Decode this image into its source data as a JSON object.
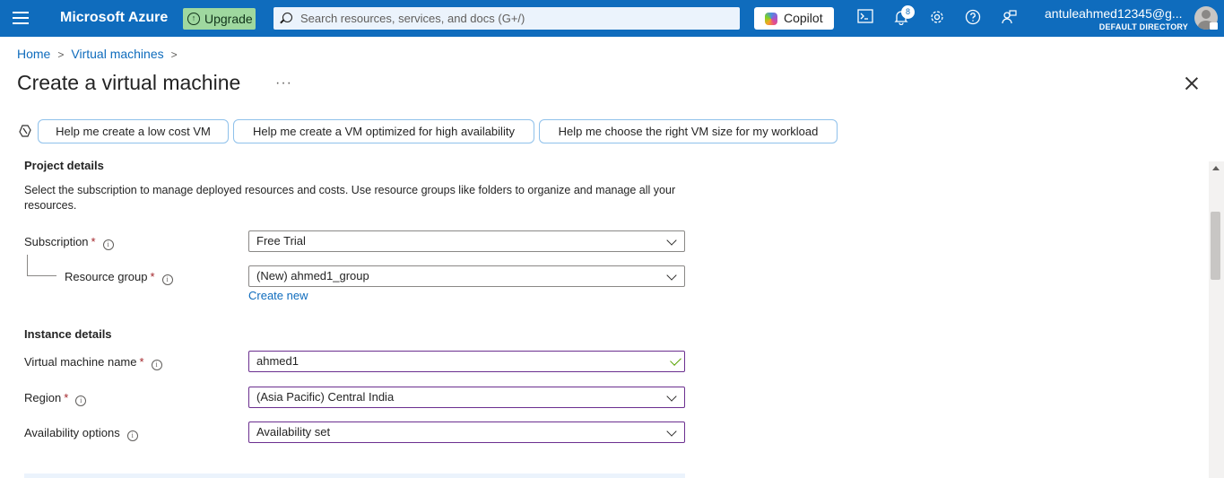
{
  "topbar": {
    "brand": "Microsoft Azure",
    "upgrade_label": "Upgrade",
    "search_placeholder": "Search resources, services, and docs (G+/)",
    "copilot_label": "Copilot",
    "notification_count": "8",
    "account_email": "antuleahmed12345@g...",
    "account_directory": "DEFAULT DIRECTORY",
    "icons": [
      "cloud-shell-icon",
      "bell-icon",
      "gear-icon",
      "help-icon",
      "feedback-icon"
    ]
  },
  "breadcrumb": {
    "home": "Home",
    "virtual_machines": "Virtual machines"
  },
  "page": {
    "title": "Create a virtual machine",
    "more": "···"
  },
  "suggestions": [
    "Help me create a low cost VM",
    "Help me create a VM optimized for high availability",
    "Help me choose the right VM size for my workload"
  ],
  "project": {
    "heading": "Project details",
    "description": "Select the subscription to manage deployed resources and costs. Use resource groups like folders to organize and manage all your resources.",
    "subscription_label": "Subscription",
    "subscription_value": "Free Trial",
    "resource_group_label": "Resource group",
    "resource_group_value": "(New) ahmed1_group",
    "create_new": "Create new"
  },
  "instance": {
    "heading": "Instance details",
    "vm_name_label": "Virtual machine name",
    "vm_name_value": "ahmed1",
    "region_label": "Region",
    "region_value": "(Asia Pacific) Central India",
    "availability_label": "Availability options",
    "availability_value": "Availability set"
  },
  "colors": {
    "topbar": "#0f6cbd",
    "upgrade": "#9fd89f",
    "link": "#0f6cbd",
    "required": "#a4262c",
    "valid": "#57a300"
  }
}
